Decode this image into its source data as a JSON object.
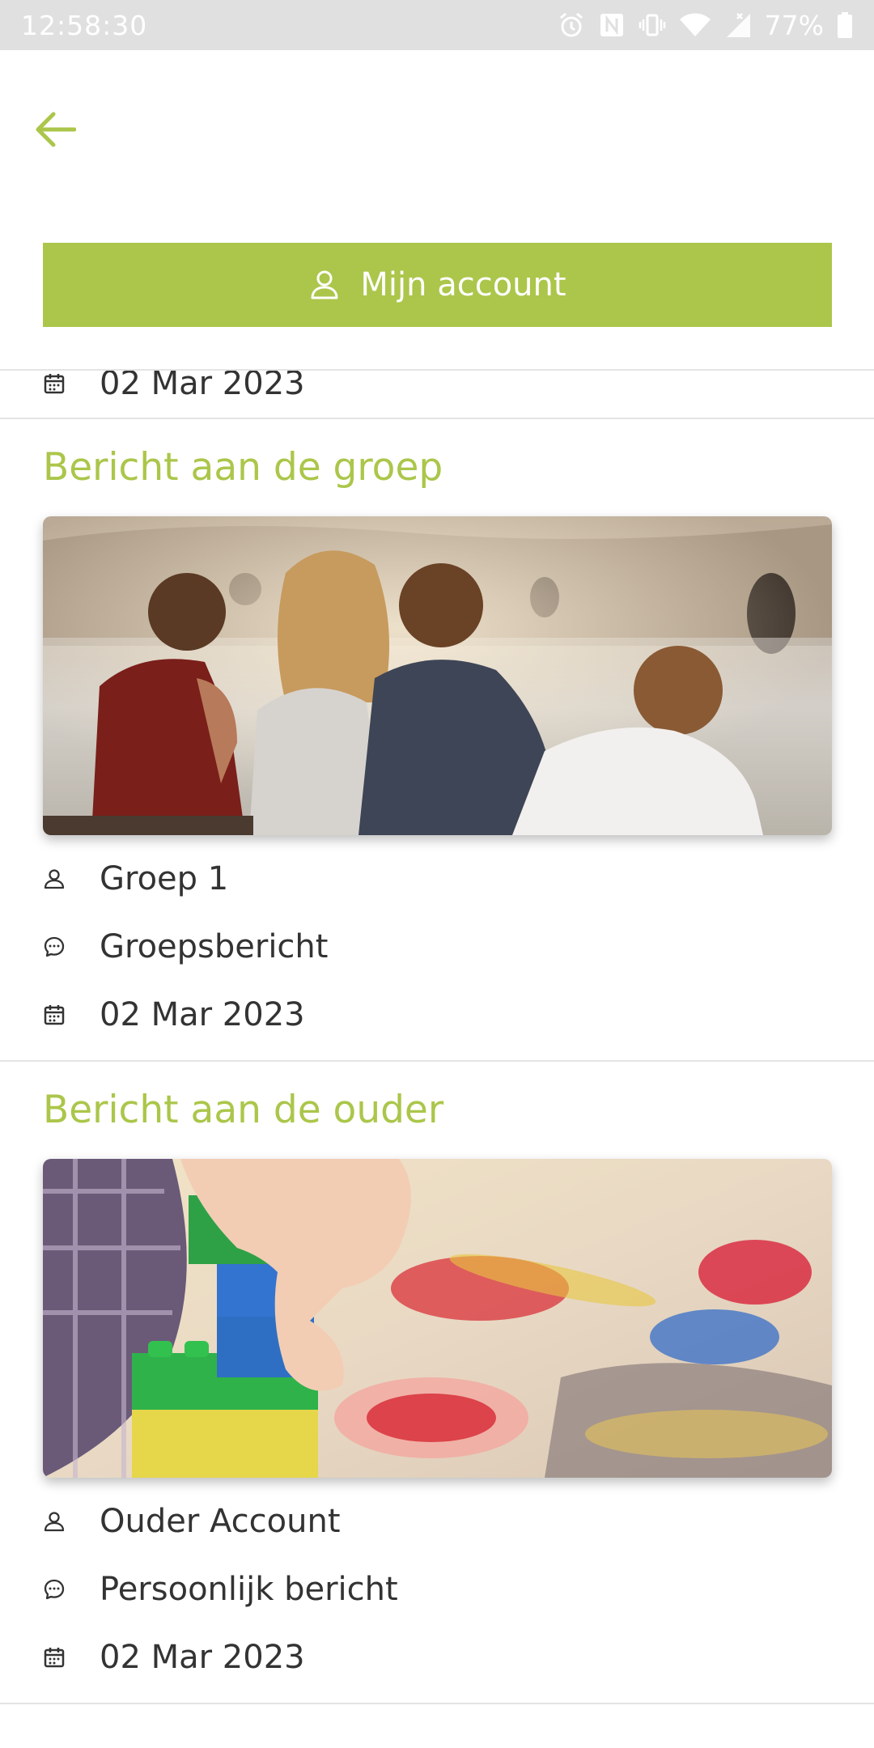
{
  "status_bar": {
    "time": "12:58:30",
    "battery": "77%",
    "icons": [
      "alarm-icon",
      "nfc-icon",
      "vibrate-icon",
      "wifi-icon",
      "signal-icon",
      "battery-icon"
    ]
  },
  "header": {
    "back_icon": "arrow-left-icon",
    "account_button_label": "Mijn account",
    "accent_color": "#abc64a"
  },
  "partial_item": {
    "date": "02 Mar 2023"
  },
  "messages": [
    {
      "title": "Bericht aan de groep",
      "image": "children-at-water-photo",
      "recipient": "Groep 1",
      "type": "Groepsbericht",
      "date": "02 Mar 2023"
    },
    {
      "title": "Bericht aan de ouder",
      "image": "building-blocks-photo",
      "recipient": "Ouder Account",
      "type": "Persoonlijk bericht",
      "date": "02 Mar 2023"
    }
  ]
}
